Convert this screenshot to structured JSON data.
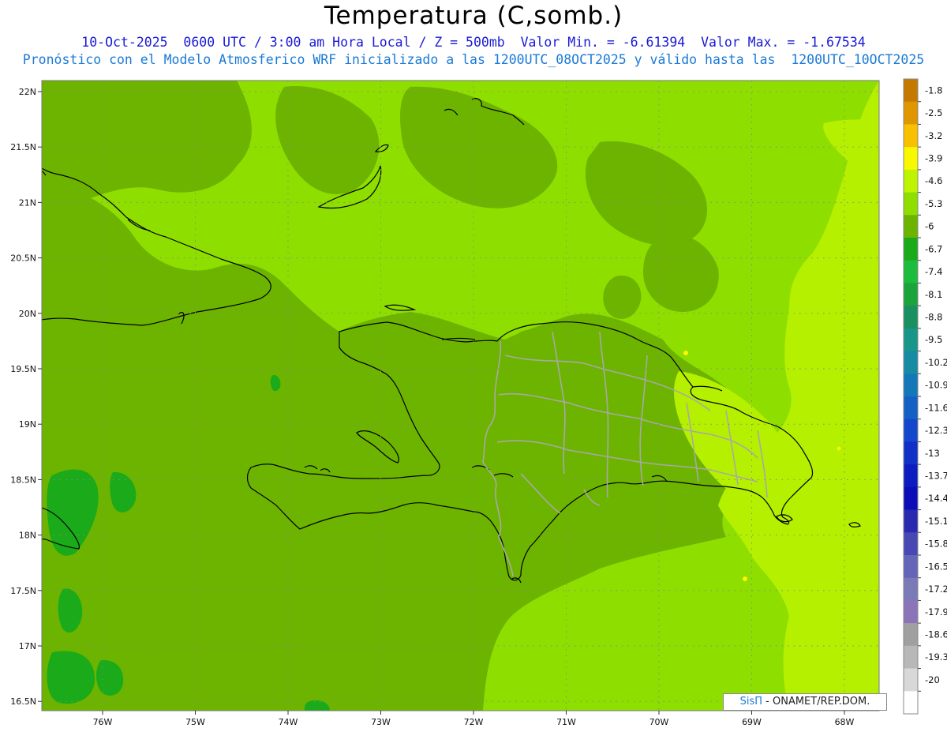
{
  "header": {
    "title": "Temperatura (C,somb.)",
    "line1": "10-Oct-2025  0600 UTC / 3:00 am Hora Local / Z = 500mb  Valor Min. = -6.61394  Valor Max. = -1.67534",
    "line2": "Pronóstico con el Modelo Atmosferico WRF inicializado a las 1200UTC_08OCT2025 y válido hasta las  1200UTC_10OCT2025"
  },
  "axes": {
    "lat_labels": [
      "22N",
      "21.5N",
      "21N",
      "20.5N",
      "20N",
      "19.5N",
      "19N",
      "18.5N",
      "18N",
      "17.5N",
      "17N",
      "16.5N"
    ],
    "lon_labels": [
      "76W",
      "75W",
      "74W",
      "73W",
      "72W",
      "71W",
      "70W",
      "69W",
      "68W"
    ]
  },
  "colorbar": {
    "labels": [
      "-1.8",
      "-2.5",
      "-3.2",
      "-3.9",
      "-4.6",
      "-5.3",
      "-6",
      "-6.7",
      "-7.4",
      "-8.1",
      "-8.8",
      "-9.5",
      "-10.2",
      "-10.9",
      "-11.6",
      "-12.3",
      "-13",
      "-13.7",
      "-14.4",
      "-15.1",
      "-15.8",
      "-16.5",
      "-17.2",
      "-17.9",
      "-18.6",
      "-19.3",
      "-20"
    ],
    "colors": [
      "#c47a00",
      "#e09600",
      "#f8c000",
      "#f8f800",
      "#bef400",
      "#8ede00",
      "#6cb400",
      "#1aaa1a",
      "#1cbc3c",
      "#1ca43c",
      "#1a9060",
      "#18968a",
      "#168ca4",
      "#1478b8",
      "#1460c4",
      "#1448cc",
      "#1030c8",
      "#0c1cc0",
      "#0c0cb8",
      "#2a2ab0",
      "#4848b4",
      "#6464b8",
      "#7a7ab8",
      "#8c74b8",
      "#a0a0a0",
      "#b8b8b8",
      "#d8d8d8",
      "#ffffff"
    ]
  },
  "map_colors": {
    "dark_green": "#6cb400",
    "mid_green": "#8ede00",
    "light_green": "#b4f000",
    "green_cold": "#1aaa1a",
    "yellow": "#f8f800",
    "coast": "#000000",
    "provinces": "#a8a8a8",
    "grid": "#8a8a8a"
  },
  "credit": {
    "brand": "SisΠ",
    "org": " - ONAMET/REP.DOM."
  }
}
